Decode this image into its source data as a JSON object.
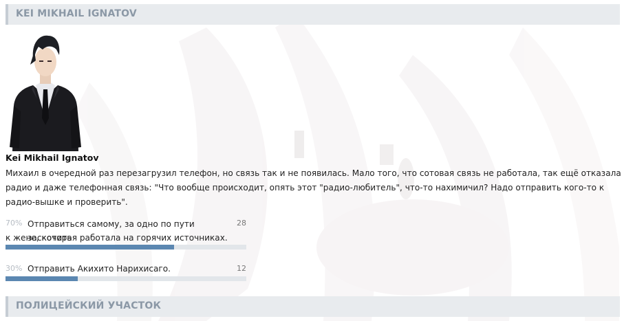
{
  "sections": {
    "top_title": "KEI MIKHAIL IGNATOV",
    "bottom_title": "ПОЛИЦЕЙСКИЙ УЧАСТОК"
  },
  "character": {
    "name": "Kei Mikhail Ignatov",
    "description": "Михаил в очередной раз перезагрузил телефон, но связь так и не появилась. Мало того, что сотовая связь не работала, так ещё отказала радио и даже телефонная связь: \"Что вообще происходит, опять этот \"радио-любитель\", что-то нахимичил? Надо отправить кого-то к радио-вышке и проверить\"."
  },
  "poll": {
    "options": [
      {
        "percent": "70%",
        "text_line1": "Отправиться самому, за одно по пути заскочить",
        "text_line2": "к жене, которая работала на горячих источниках.",
        "count": "28",
        "fill": 0.7
      },
      {
        "percent": "30%",
        "text_line1": "Отправить Акихито Нарихисаго.",
        "count": "12",
        "fill": 0.3
      }
    ]
  },
  "colors": {
    "header_bg": "#e8ebee",
    "header_text": "#8b98a6",
    "bar_fill": "#5b87b1",
    "bar_track": "#e2e6ea"
  }
}
